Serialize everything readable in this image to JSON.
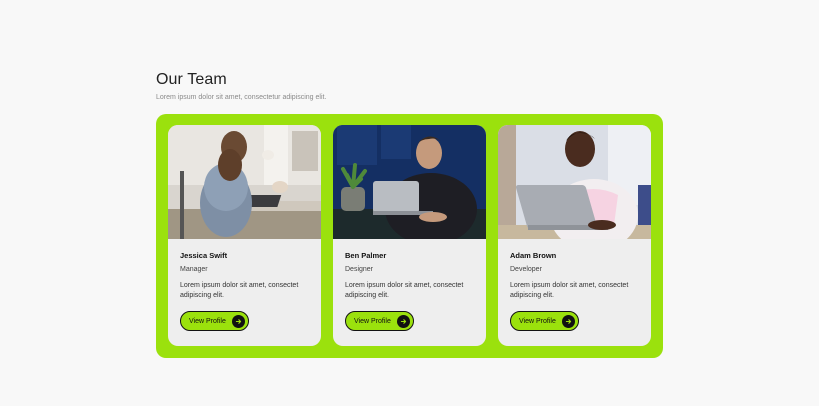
{
  "header": {
    "title": "Our Team",
    "subtitle": "Lorem ipsum dolor sit amet, consectetur adipiscing elit."
  },
  "colors": {
    "accent": "#9be10d",
    "card_bg": "#eeeeee",
    "page_bg": "#f8f8f8"
  },
  "members": [
    {
      "name": "Jessica Swift",
      "role": "Manager",
      "description": "Lorem ipsum dolor sit amet, consectet adipiscing elit.",
      "button_label": "View Profile",
      "button_icon": "arrow-right-icon"
    },
    {
      "name": "Ben Palmer",
      "role": "Designer",
      "description": "Lorem ipsum dolor sit amet, consectet adipiscing elit.",
      "button_label": "View Profile",
      "button_icon": "arrow-right-icon"
    },
    {
      "name": "Adam Brown",
      "role": "Developer",
      "description": "Lorem ipsum dolor sit amet, consectet adipiscing elit.",
      "button_label": "View Profile",
      "button_icon": "arrow-right-icon"
    }
  ]
}
